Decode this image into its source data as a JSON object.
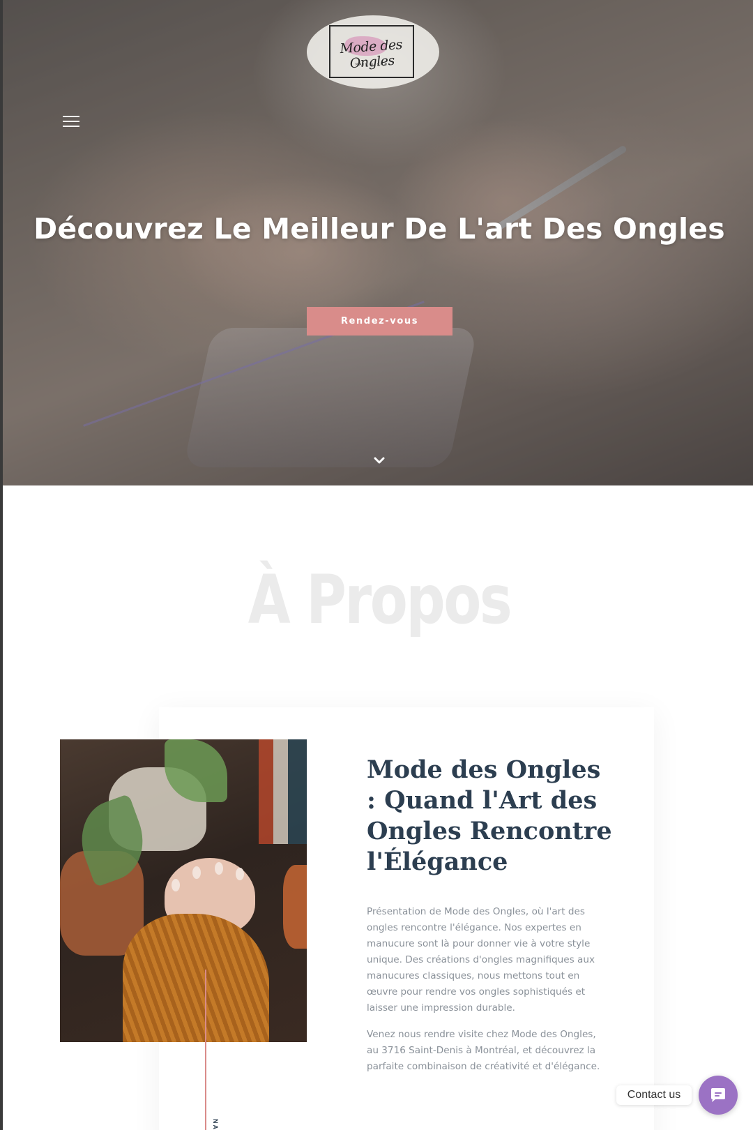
{
  "brand": {
    "logo_text": "Mode des Ongles",
    "logo_subtext": "NAIL & SPA"
  },
  "hero": {
    "title": "Découvrez Le Meilleur De L'art Des Ongles",
    "cta_label": "Rendez-vous",
    "menu_icon": "hamburger-menu-icon",
    "scroll_icon": "chevron-down-icon"
  },
  "about": {
    "heading": "À Propos",
    "title": "Mode des Ongles : Quand l'Art des Ongles Rencontre l'Élégance",
    "paragraph_1": "Présentation de Mode des Ongles, où l'art des ongles rencontre l'élégance. Nos expertes en manucure sont là pour donner vie à votre style unique. Des créations d'ongles magnifiques aux manucures classiques, nous mettons tout en œuvre pour rendre vos ongles sophistiqués et laisser une impression durable.",
    "paragraph_2": "Venez nous rendre visite chez Mode des Ongles, au 3716 Saint-Denis à Montréal, et découvrez la parfaite combinaison de créativité et d'élégance.",
    "vertical_label": "NA"
  },
  "contact_widget": {
    "label": "Contact us",
    "icon": "chat-bubble-icon"
  },
  "colors": {
    "accent": "#d98c8a",
    "title": "#2c3e50",
    "body_text": "#8a9199",
    "heading_ghost": "#ebebeb",
    "widget": "#9b72c4"
  }
}
